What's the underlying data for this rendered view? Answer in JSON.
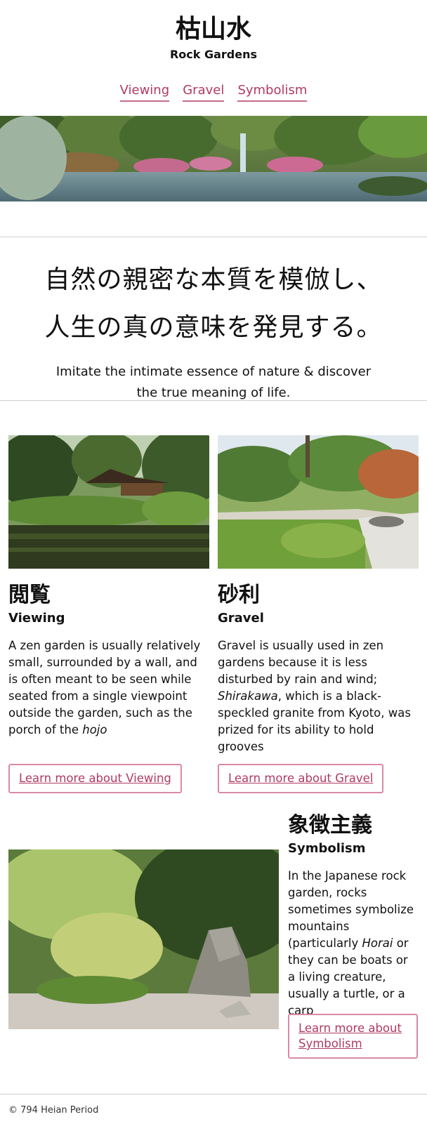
{
  "header": {
    "title_jp": "枯山水",
    "title_en": "Rock Gardens"
  },
  "nav": {
    "items": [
      {
        "label": "Viewing"
      },
      {
        "label": "Gravel"
      },
      {
        "label": "Symbolism"
      }
    ]
  },
  "tagline": {
    "jp": "自然の親密な本質を模倣し、\n人生の真の意味を発見する。",
    "en": "Imitate the intimate essence of nature & discover the true meaning of life."
  },
  "sections": [
    {
      "title_jp": "閲覧",
      "title_en": "Viewing",
      "text_before": "A zen garden is usually relatively small, surrounded by a wall, and is often meant to be seen while seated from a single viewpoint outside the garden, such as the porch of the ",
      "text_em": "hojo",
      "text_after": "",
      "button": "Learn more about Viewing"
    },
    {
      "title_jp": "砂利",
      "title_en": "Gravel",
      "text_before": "Gravel is usually used in zen gardens because it is less disturbed by rain and wind; ",
      "text_em": "Shirakawa",
      "text_after": ", which is a black-speckled granite from Kyoto, was prized for its ability to hold grooves",
      "button": "Learn more about Gravel"
    },
    {
      "title_jp": "象徴主義",
      "title_en": "Symbolism",
      "text_before": "In the Japanese rock garden, rocks sometimes symbolize mountains (particularly ",
      "text_em": "Horai",
      "text_after": " or they can be boats or a living creature, usually a turtle, or a carp",
      "button": "Learn more about Symbolism"
    }
  ],
  "footer": {
    "text": "© 794 Heian Period"
  },
  "colors": {
    "accent": "#b03a63",
    "accent_border": "#d98aa6",
    "rule": "#cfcfcf"
  }
}
